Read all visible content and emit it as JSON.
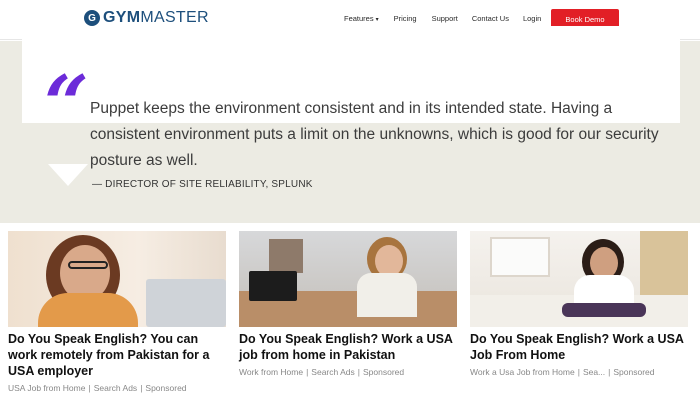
{
  "header": {
    "logo_letter": "G",
    "logo_gym": "GYM",
    "logo_master": "MASTER",
    "nav": [
      "Features",
      "Pricing",
      "Support",
      "Contact Us",
      "Login"
    ],
    "features_caret": "▾",
    "book_demo": "Book Demo"
  },
  "testimonial": {
    "quote_mark": "“",
    "text": "Puppet keeps the environment consistent and in its intended state. Having a consistent environment puts a limit on the unknowns, which is good for our security posture as well.",
    "attribution": "— DIRECTOR OF SITE RELIABILITY, SPLUNK"
  },
  "ads": [
    {
      "title": "Do You Speak English? You can work remotely from Pakistan for a USA employer",
      "source": "USA Job from Home",
      "sponsor": "Search Ads",
      "label": "Sponsored"
    },
    {
      "title": "Do You Speak English? Work a USA job from home in Pakistan",
      "source": "Work from Home",
      "sponsor": "Search Ads",
      "label": "Sponsored"
    },
    {
      "title": "Do You Speak English? Work a USA Job From Home",
      "source": "Work a Usa Job from Home",
      "sponsor": "Sea...",
      "label": "Sponsored"
    }
  ],
  "colors": {
    "brand_blue": "#1d4f7c",
    "cta_red": "#e21f26",
    "quote_purple": "#6c2bd9",
    "section_bg": "#ecebe3"
  }
}
